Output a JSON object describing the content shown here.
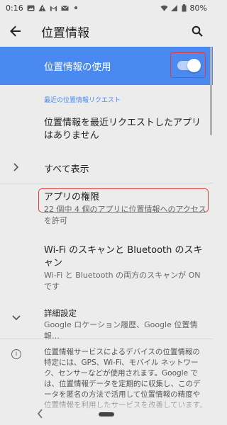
{
  "status_bar": {
    "time": "0:16",
    "battery": "80%"
  },
  "app_bar": {
    "title": "位置情報"
  },
  "master_switch": {
    "label": "位置情報の使用",
    "on": true
  },
  "recent_section": {
    "header": "最近の位置情報リクエスト",
    "empty_text": "位置情報を最近リクエストしたアプリはありません",
    "see_all": "すべて表示"
  },
  "app_permission": {
    "title": "アプリの権限",
    "summary": "22 個中 4 個のアプリに位置情報へのアクセスを許可"
  },
  "wifi_bt_scan": {
    "title": "Wi-Fi のスキャンと Bluetooth のスキャン",
    "summary": "Wi-Fi と Bluetooth の両方のスキャンが ON です"
  },
  "advanced": {
    "title": "詳細設定",
    "summary": "Google ロケーション履歴、Google 位置情報…"
  },
  "footer_info": {
    "text": "位置情報サービスによるデバイスの位置情報の特定には、GPS、Wi-Fi、モバイル ネットワーク、センサーなどが使用されます。Google では、位置情報データを定期的に収集し、このデータを匿名の方法で活用して位置情報の精度や位置情報を利用したサービスを改善しています。"
  },
  "colors": {
    "accent": "#4a89f0",
    "highlight": "#e23b3b",
    "background": "#ececec"
  }
}
